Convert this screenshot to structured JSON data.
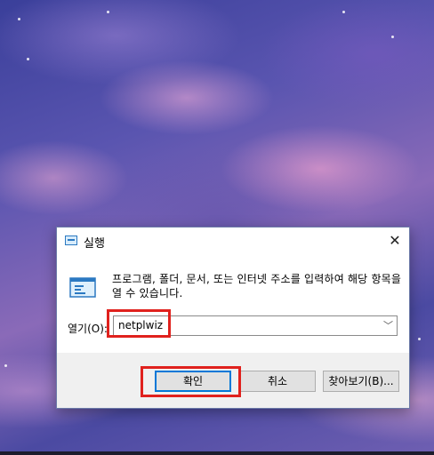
{
  "dialog": {
    "title": "실행",
    "close_glyph": "✕",
    "description": "프로그램, 폴더, 문서, 또는 인터넷 주소를 입력하여 해당 항목을 열 수 있습니다.",
    "open_label": "열기(O):",
    "open_value": "netplwiz",
    "ok_label": "확인",
    "cancel_label": "취소",
    "browse_label": "찾아보기(B)..."
  },
  "icons": [
    "run-icon",
    "close-icon",
    "run-large-icon",
    "chevron-down-icon"
  ],
  "colors": {
    "highlight": "#e0211d",
    "focus_border": "#0078d7",
    "footer_bg": "#f0f0f0"
  }
}
